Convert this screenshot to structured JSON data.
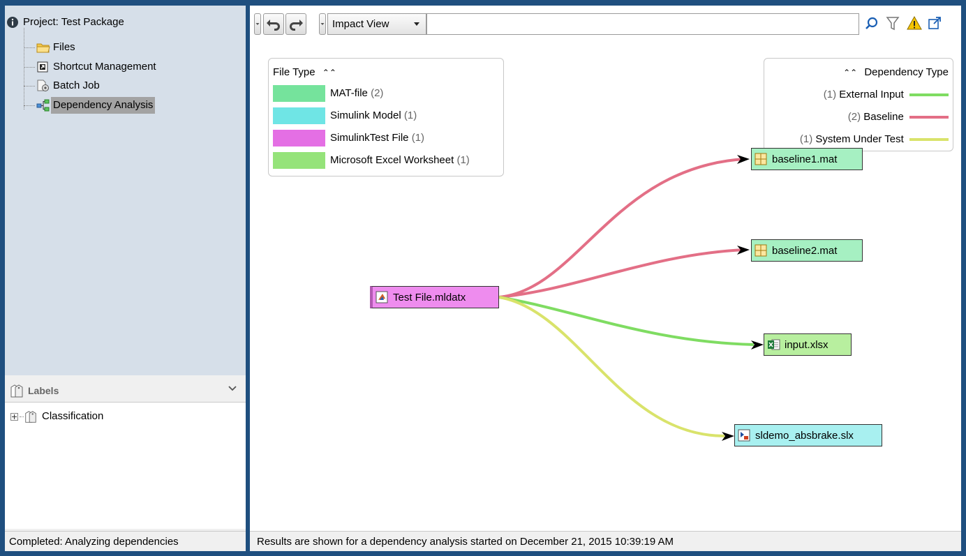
{
  "tree": {
    "project_label": "Project: Test Package",
    "items": [
      {
        "label": "Files",
        "icon": "folder-icon"
      },
      {
        "label": "Shortcut Management",
        "icon": "shortcut-icon"
      },
      {
        "label": "Batch Job",
        "icon": "batch-job-icon"
      },
      {
        "label": "Dependency Analysis",
        "icon": "dependency-analysis-icon",
        "selected": true
      }
    ]
  },
  "labels_panel": {
    "title": "Labels",
    "items": [
      {
        "label": "Classification"
      }
    ]
  },
  "status": {
    "left": "Completed: Analyzing dependencies",
    "right": "Results are shown for a dependency analysis started on December 21, 2015 10:39:19 AM"
  },
  "toolbar": {
    "view_label": "Impact View",
    "search_value": "",
    "search_placeholder": ""
  },
  "file_type_legend": {
    "title": "File Type",
    "entries": [
      {
        "name": "MAT-file",
        "count": "(2)",
        "color": "#75e39c"
      },
      {
        "name": "Simulink Model",
        "count": "(1)",
        "color": "#6fe5e5"
      },
      {
        "name": "SimulinkTest File",
        "count": "(1)",
        "color": "#e46fe4"
      },
      {
        "name": "Microsoft Excel Worksheet",
        "count": "(1)",
        "color": "#95e37a"
      }
    ]
  },
  "dependency_type_legend": {
    "title": "Dependency Type",
    "entries": [
      {
        "count": "(1)",
        "name": "External Input",
        "color": "#7fdc62"
      },
      {
        "count": "(2)",
        "name": "Baseline",
        "color": "#e36f86"
      },
      {
        "count": "(1)",
        "name": "System Under Test",
        "color": "#d9e36b"
      }
    ]
  },
  "graph": {
    "source": {
      "label": "Test File.mldatx",
      "color": "#ee8cee",
      "icon": "simulink-test-file-icon"
    },
    "targets": [
      {
        "label": "baseline1.mat",
        "color": "#a6f0c2",
        "icon": "mat-file-icon",
        "dependency": "Baseline"
      },
      {
        "label": "baseline2.mat",
        "color": "#a6f0c2",
        "icon": "mat-file-icon",
        "dependency": "Baseline"
      },
      {
        "label": "input.xlsx",
        "color": "#b8ef9f",
        "icon": "excel-file-icon",
        "dependency": "External Input"
      },
      {
        "label": "sldemo_absbrake.slx",
        "color": "#a8f0f0",
        "icon": "simulink-model-icon",
        "dependency": "System Under Test"
      }
    ]
  }
}
